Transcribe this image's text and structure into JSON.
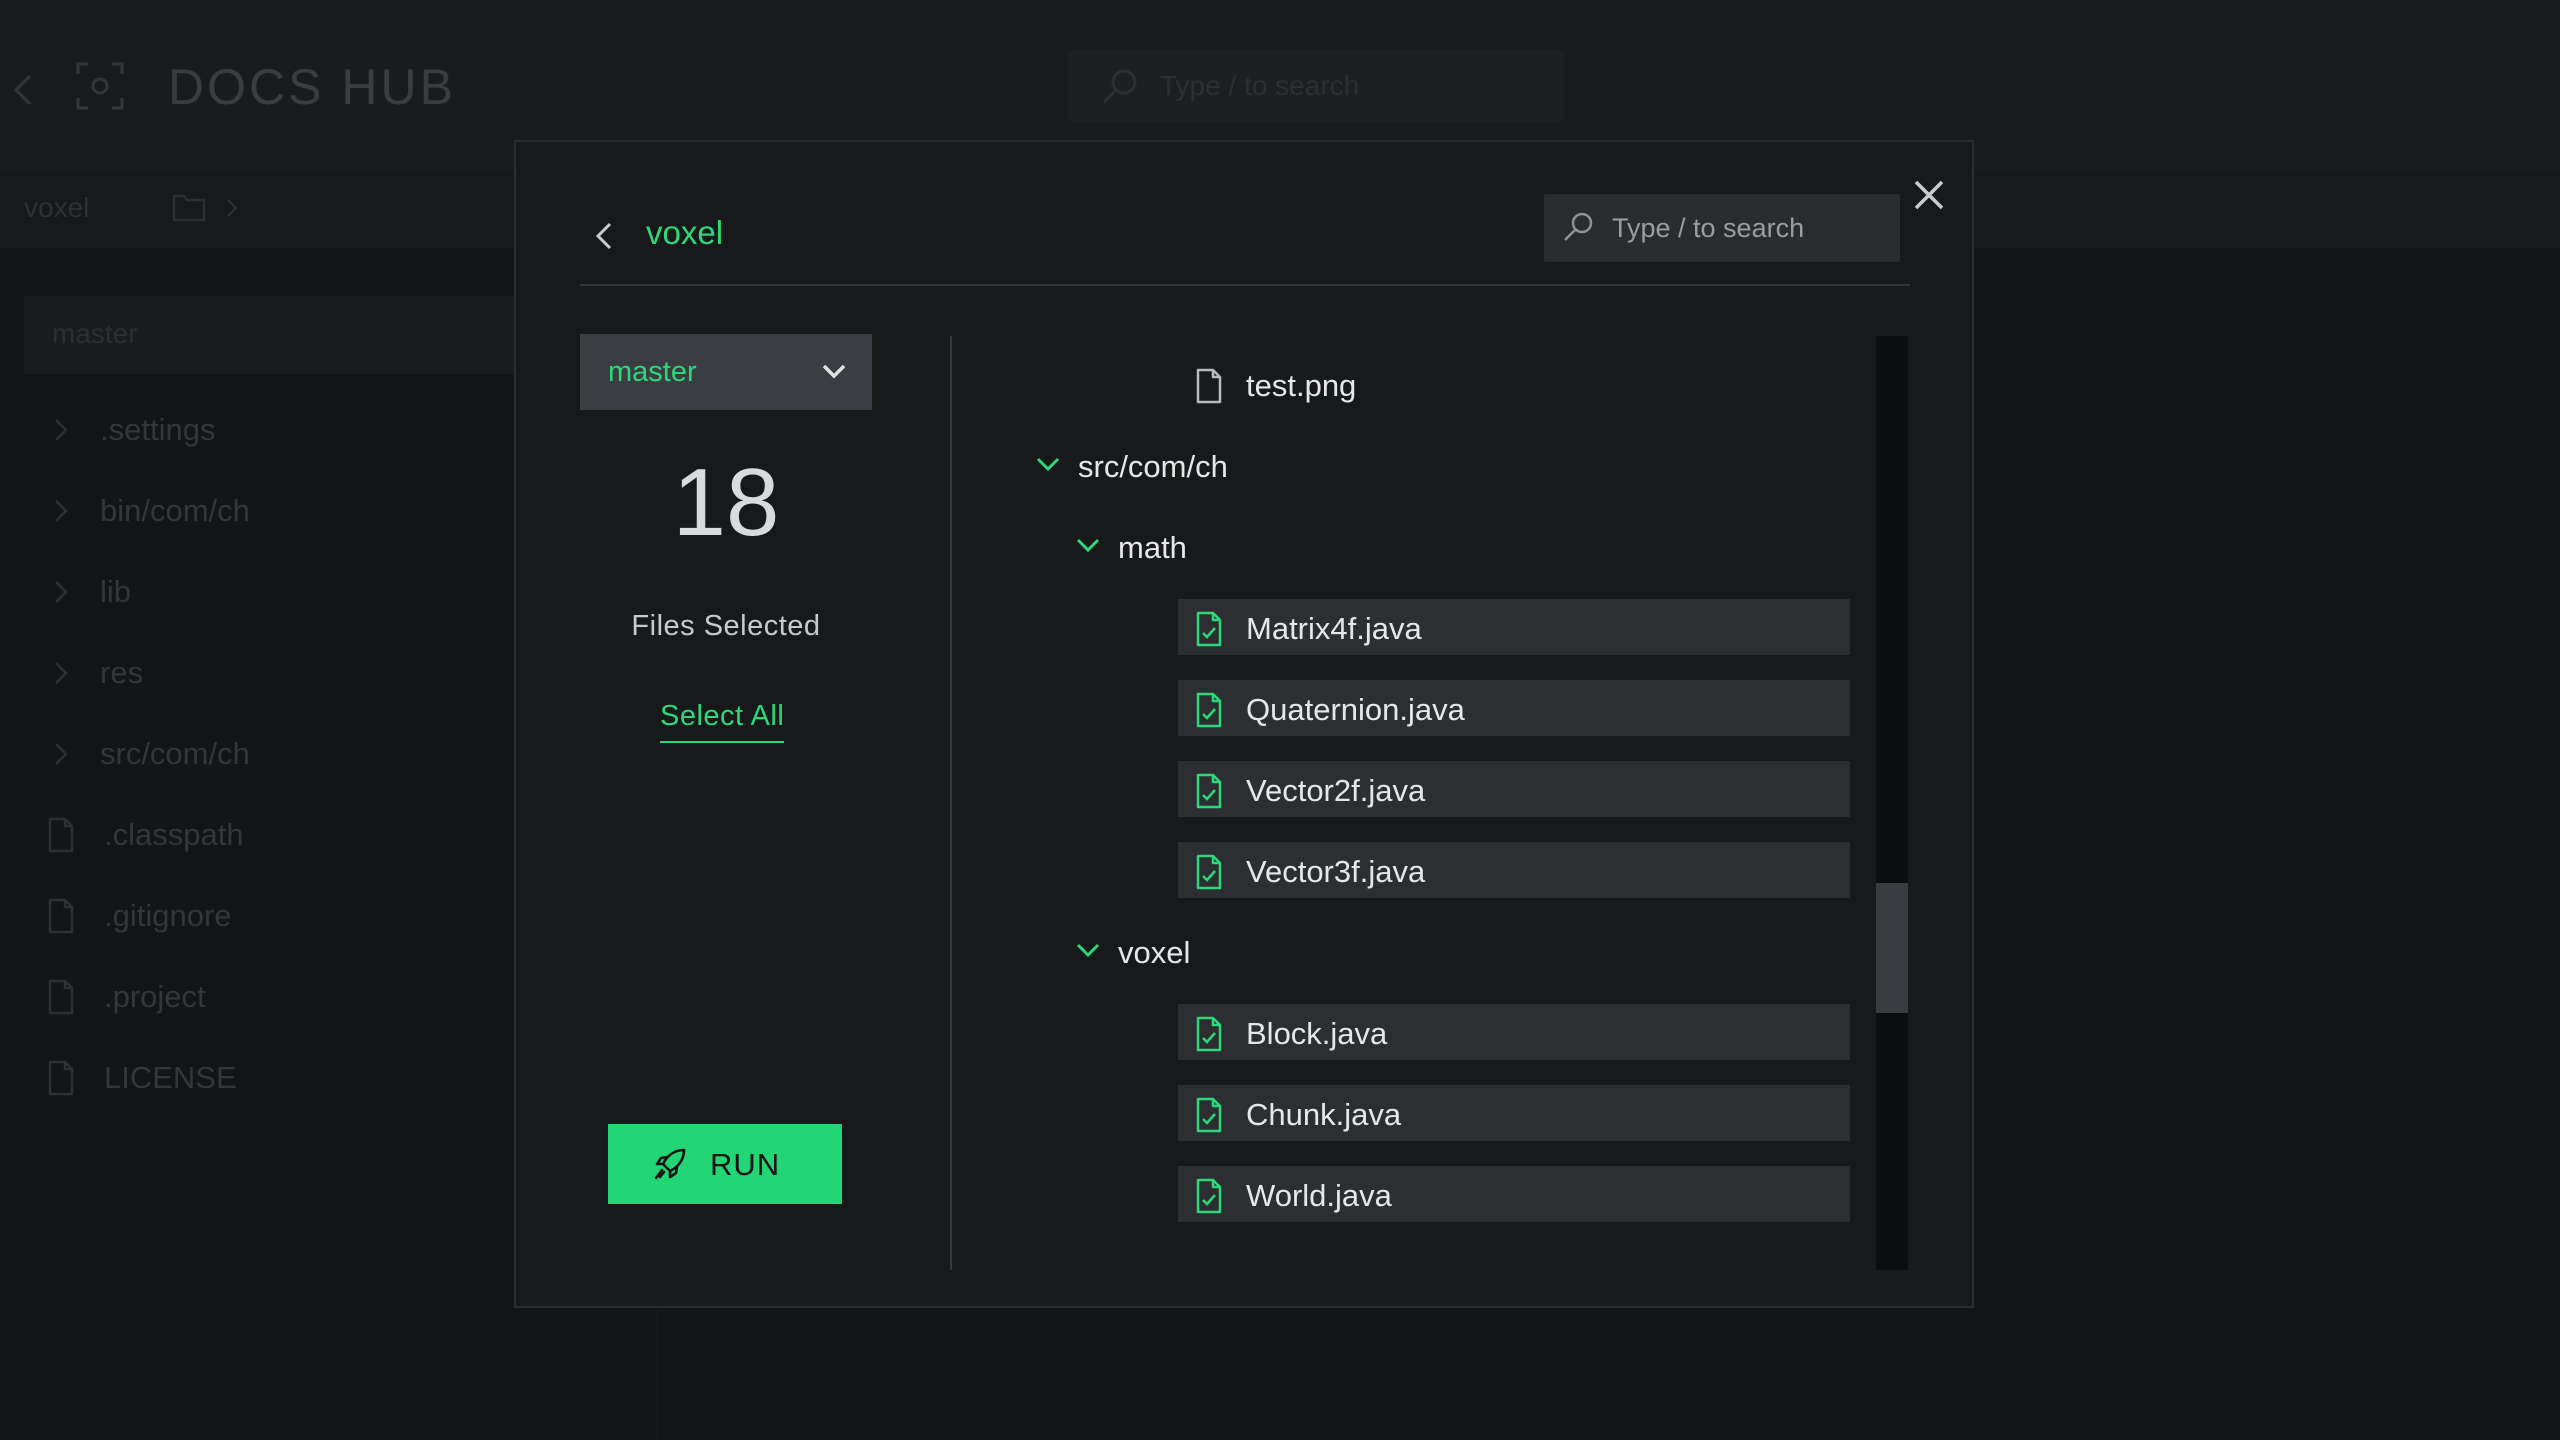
{
  "app": {
    "title": "DOCS HUB",
    "search_placeholder": "Type / to search"
  },
  "background": {
    "breadcrumb": "voxel",
    "branch": "master",
    "tree": [
      {
        "label": ".settings",
        "kind": "folder"
      },
      {
        "label": "bin/com/ch",
        "kind": "folder"
      },
      {
        "label": "lib",
        "kind": "folder"
      },
      {
        "label": "res",
        "kind": "folder"
      },
      {
        "label": "src/com/ch",
        "kind": "folder"
      },
      {
        "label": ".classpath",
        "kind": "file"
      },
      {
        "label": ".gitignore",
        "kind": "file"
      },
      {
        "label": ".project",
        "kind": "file"
      },
      {
        "label": "LICENSE",
        "kind": "file"
      }
    ]
  },
  "modal": {
    "title": "voxel",
    "search_placeholder": "Type / to search",
    "branch": "master",
    "files_selected_count": "18",
    "files_selected_label": "Files Selected",
    "select_all_label": "Select All",
    "run_label": "RUN",
    "scroll_position": 0.68,
    "tree": [
      {
        "label": "test.png",
        "kind": "file",
        "depth": 2,
        "selected": false
      },
      {
        "label": "src/com/ch",
        "kind": "folder",
        "depth": 0,
        "expanded": true
      },
      {
        "label": "math",
        "kind": "folder",
        "depth": 1,
        "expanded": true
      },
      {
        "label": "Matrix4f.java",
        "kind": "file",
        "depth": 2,
        "selected": true
      },
      {
        "label": "Quaternion.java",
        "kind": "file",
        "depth": 2,
        "selected": true
      },
      {
        "label": "Vector2f.java",
        "kind": "file",
        "depth": 2,
        "selected": true
      },
      {
        "label": "Vector3f.java",
        "kind": "file",
        "depth": 2,
        "selected": true
      },
      {
        "label": "voxel",
        "kind": "folder",
        "depth": 1,
        "expanded": true
      },
      {
        "label": "Block.java",
        "kind": "file",
        "depth": 2,
        "selected": true
      },
      {
        "label": "Chunk.java",
        "kind": "file",
        "depth": 2,
        "selected": true
      },
      {
        "label": "World.java",
        "kind": "file",
        "depth": 2,
        "selected": true
      }
    ]
  },
  "colors": {
    "accent": "#22d676",
    "background": "#131517",
    "modal": "#18191b",
    "selected_row": "#2c2e31"
  }
}
